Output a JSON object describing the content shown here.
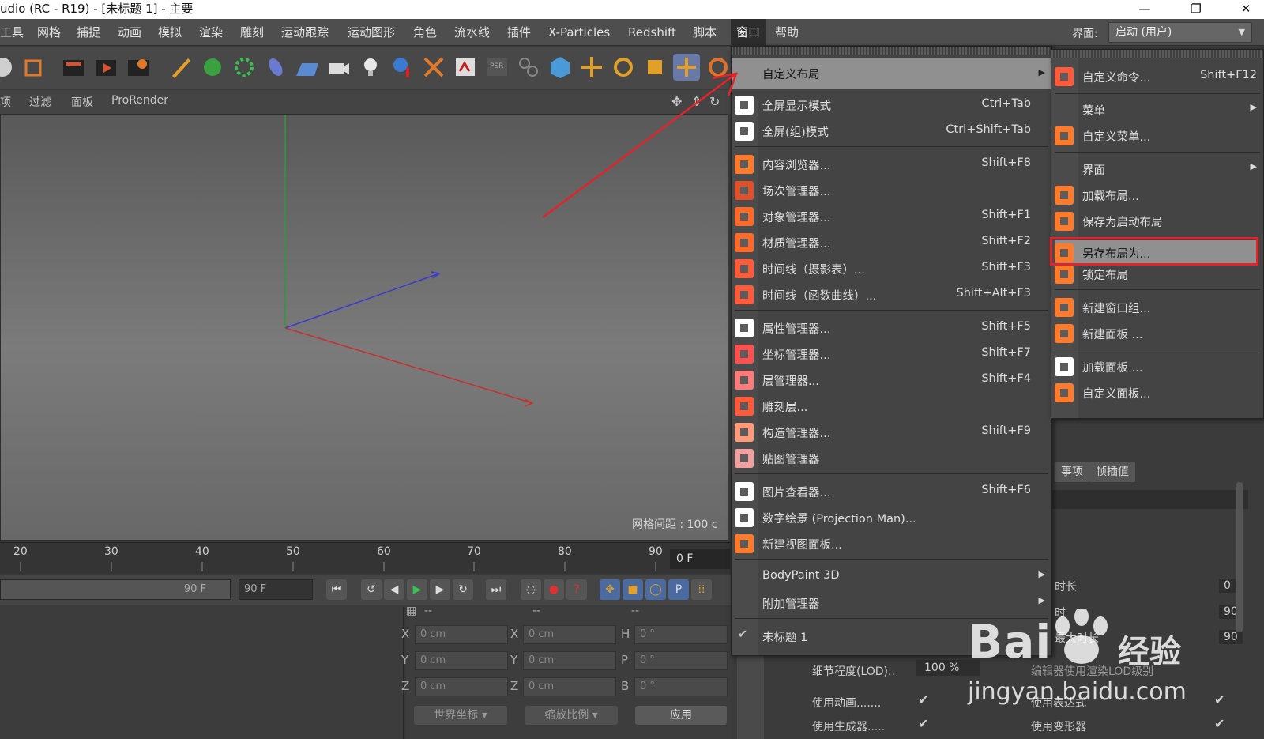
{
  "window": {
    "title": "udio (RC - R19) - [未标题 1] - 主要",
    "minimize": "—",
    "restore": "❐",
    "close": "✕"
  },
  "menubar": {
    "items": [
      "工具",
      "网格",
      "捕捉",
      "动画",
      "模拟",
      "渲染",
      "雕刻",
      "运动跟踪",
      "运动图形",
      "角色",
      "流水线",
      "插件",
      "X-Particles",
      "Redshift",
      "脚本",
      "窗口",
      "帮助"
    ],
    "active": "窗口",
    "layout_label": "界面:",
    "layout_value": "启动 (用户)"
  },
  "viewport": {
    "menu": [
      "项",
      "过滤",
      "面板",
      "ProRender"
    ],
    "grid_spacing": "网格间距 : 100 c"
  },
  "timeline": {
    "ticks": [
      "20",
      "30",
      "40",
      "50",
      "60",
      "70",
      "80",
      "90"
    ],
    "current_frame": "0 F",
    "end_frame_slider": "90 F",
    "end_frame_field": "90 F"
  },
  "coords": {
    "col_headers": [
      "--",
      "--",
      "--"
    ],
    "rows": [
      {
        "a": "X",
        "av": "0 cm",
        "b": "X",
        "bv": "0 cm",
        "c": "H",
        "cv": "0 °"
      },
      {
        "a": "Y",
        "av": "0 cm",
        "b": "Y",
        "bv": "0 cm",
        "c": "P",
        "cv": "0 °"
      },
      {
        "a": "Z",
        "av": "0 cm",
        "b": "Z",
        "bv": "0 cm",
        "c": "B",
        "cv": "0 °"
      }
    ],
    "mode_world": "世界坐标",
    "mode_scale": "缩放比例",
    "apply": "应用"
  },
  "attributes": {
    "tabs": [
      "事项",
      "帧插值"
    ],
    "rows": [
      "时长",
      "时",
      "最大时长"
    ],
    "values": [
      "0",
      "90",
      "90"
    ],
    "lod_label": "细节程度(LOD)..",
    "lod_value": "100 %",
    "lod_right": "编辑器使用渲染LOD级别",
    "use_anim": "使用动画.......",
    "use_gen": "使用生成器.....",
    "use_expr": "使用表达式",
    "use_deform": "使用变形器"
  },
  "menu_window": {
    "items": [
      {
        "label": "自定义布局",
        "shortcut": "",
        "submenu": true,
        "color": "#e04040"
      },
      {
        "label": "全屏显示模式",
        "shortcut": "Ctrl+Tab",
        "color": "#ffffff"
      },
      {
        "label": "全屏(组)模式",
        "shortcut": "Ctrl+Shift+Tab",
        "color": "#ffffff"
      },
      {
        "label": "内容浏览器...",
        "shortcut": "Shift+F8",
        "color": "#ff7a2a"
      },
      {
        "label": "场次管理器...",
        "shortcut": "",
        "color": "#e0502a"
      },
      {
        "label": "对象管理器...",
        "shortcut": "Shift+F1",
        "color": "#ff6a2a"
      },
      {
        "label": "材质管理器...",
        "shortcut": "Shift+F2",
        "color": "#ff6a2a"
      },
      {
        "label": "时间线（摄影表）...",
        "shortcut": "Shift+F3",
        "color": "#ff5a3a"
      },
      {
        "label": "时间线（函数曲线）...",
        "shortcut": "Shift+Alt+F3",
        "color": "#ff5a3a"
      },
      {
        "label": "属性管理器...",
        "shortcut": "Shift+F5",
        "color": "#ffffff"
      },
      {
        "label": "坐标管理器...",
        "shortcut": "Shift+F7",
        "color": "#ff5050"
      },
      {
        "label": "层管理器...",
        "shortcut": "Shift+F4",
        "color": "#ff7a7a"
      },
      {
        "label": "雕刻层...",
        "shortcut": "",
        "color": "#ff5a3a"
      },
      {
        "label": "构造管理器...",
        "shortcut": "Shift+F9",
        "color": "#ff9a7a"
      },
      {
        "label": "贴图管理器",
        "shortcut": "",
        "color": "#f0a0a0"
      },
      {
        "label": "图片查看器...",
        "shortcut": "Shift+F6",
        "color": "#ffffff"
      },
      {
        "label": "数字绘景 (Projection Man)...",
        "shortcut": "",
        "color": "#ffffff"
      },
      {
        "label": "新建视图面板...",
        "shortcut": "",
        "color": "#ff7a2a"
      },
      {
        "label": "BodyPaint 3D",
        "shortcut": "",
        "submenu": true
      },
      {
        "label": "附加管理器",
        "shortcut": "",
        "submenu": true
      },
      {
        "label": "未标题 1",
        "shortcut": "",
        "check": true
      }
    ]
  },
  "menu_layout": {
    "items": [
      {
        "label": "自定义命令...",
        "shortcut": "Shift+F12",
        "color": "#ff5a3a"
      },
      {
        "label": "菜单",
        "submenu": true
      },
      {
        "label": "自定义菜单...",
        "color": "#ff7a2a"
      },
      {
        "label": "界面",
        "submenu": true
      },
      {
        "label": "加载布局...",
        "color": "#ff7a2a"
      },
      {
        "label": "保存为启动布局",
        "color": "#ff7a2a"
      },
      {
        "label": "另存布局为...",
        "color": "#ff7a2a"
      },
      {
        "label": "锁定布局",
        "color": "#ff7a2a"
      },
      {
        "label": "新建窗口组...",
        "color": "#ff7a2a"
      },
      {
        "label": "新建面板 ...",
        "color": "#ff7a2a"
      },
      {
        "label": "加载面板 ...",
        "color": "#ffffff"
      },
      {
        "label": "自定义面板...",
        "color": "#ff7a2a"
      }
    ]
  },
  "watermark": {
    "brand": "Bai",
    "brand_cn": "经验",
    "url": "jingyan.baidu.com"
  }
}
